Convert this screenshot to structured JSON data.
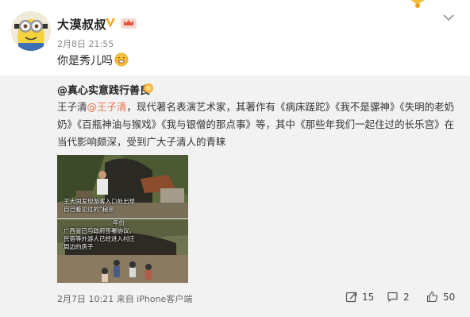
{
  "post": {
    "author": "大漠叔叔",
    "date": "2月8日 21:55",
    "text": "你是秀儿吗"
  },
  "repost": {
    "author": "@真心实意践行善良",
    "body_prefix": "王子清",
    "mention": "@王子清",
    "body_middle": "，现代著名表演艺术家，其著作有",
    "works": [
      "《病床蹉跎》",
      "《我不是骡神》",
      "《失明的老奶奶》",
      "《百瓶神油与猴戏》",
      "《我与银僧的那点事》"
    ],
    "body_after_works": "等，其中",
    "featured_work": "《那些年我们一起住过的长乐宫》",
    "body_suffix": "在当代影响颇深，受到广大子清人的青睐",
    "photo1_caption": "王大国发现游客入口处出现\n自己看见过的“秘密",
    "photo2_caption": "广西省已与政府签署协议，\n民宿等外游人已经进入村庄\n周边的房子",
    "photo2_caption_top": "年份",
    "footer_time": "2月7日 10:21 来自 iPhone客户端",
    "reposts": "15",
    "comments": "2",
    "likes": "50"
  },
  "colors": {
    "link": "#eb7350",
    "vbadge": "#f6a623",
    "background_repost": "#f2f2f2"
  },
  "icons": {
    "avatar": "minion-avatar",
    "verified": "v-badge-icon",
    "member": "crown-member-icon",
    "menu": "chevron-down-icon",
    "repost": "repost-icon",
    "comment": "comment-icon",
    "like": "thumbs-up-icon"
  }
}
